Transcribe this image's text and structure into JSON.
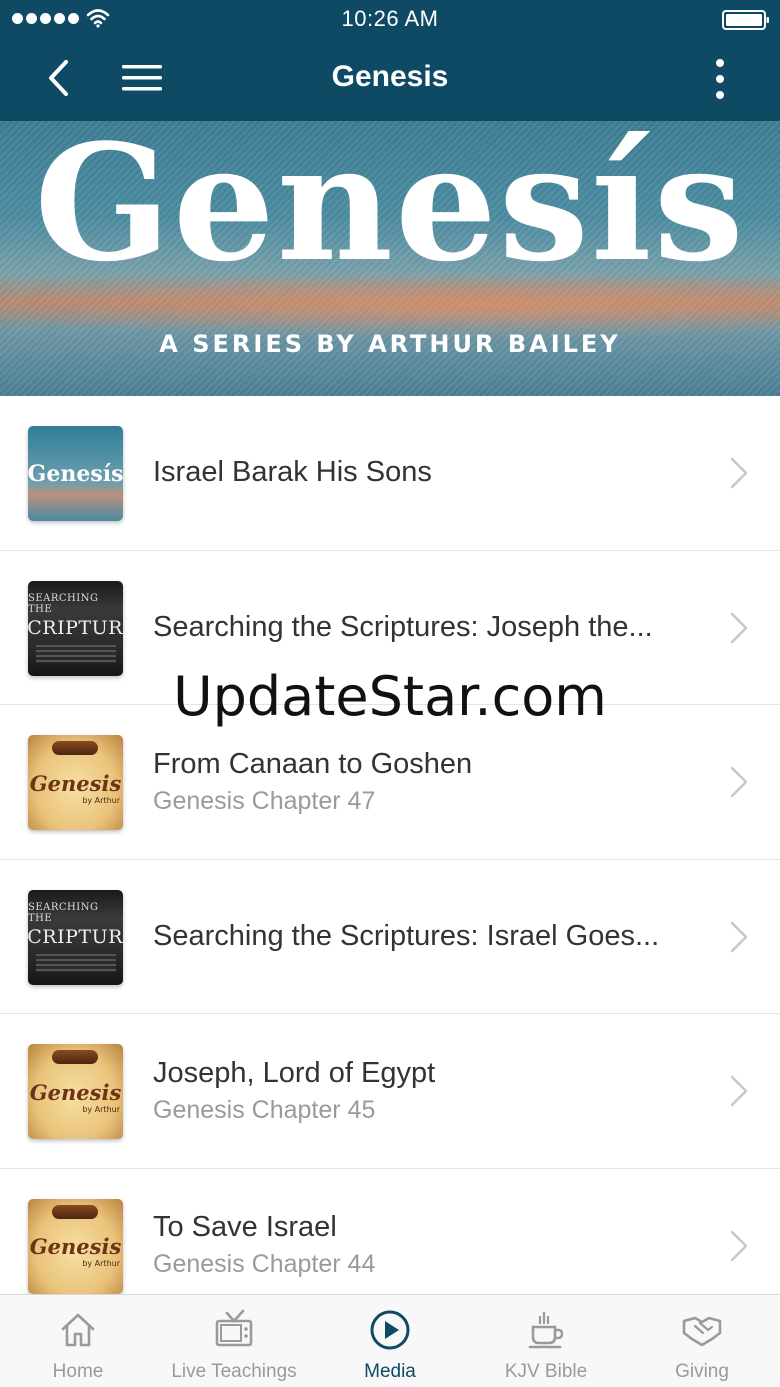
{
  "status_bar": {
    "time": "10:26 AM"
  },
  "nav": {
    "title": "Genesis"
  },
  "banner": {
    "title": "Genesís",
    "subtitle": "A SERIES BY ARTHUR BAILEY"
  },
  "list": {
    "items": [
      {
        "title": "Israel Barak His Sons",
        "subtitle": "",
        "thumb": "genesis-teal",
        "thumb_text": "Genesís"
      },
      {
        "title": "Searching the Scriptures: Joseph the...",
        "subtitle": "",
        "thumb": "searching-scriptures",
        "thumb_small": "SEARCHING THE",
        "thumb_big": "SCRIPTURE"
      },
      {
        "title": "From Canaan to Goshen",
        "subtitle": "Genesis Chapter 47",
        "thumb": "genesis-parchment",
        "thumb_text": "Genesis",
        "thumb_by": "by Arthur"
      },
      {
        "title": "Searching the Scriptures: Israel Goes...",
        "subtitle": "",
        "thumb": "searching-scriptures",
        "thumb_small": "SEARCHING THE",
        "thumb_big": "SCRIPTURE"
      },
      {
        "title": "Joseph, Lord of Egypt",
        "subtitle": "Genesis Chapter 45",
        "thumb": "genesis-parchment",
        "thumb_text": "Genesis",
        "thumb_by": "by Arthur"
      },
      {
        "title": "To Save Israel",
        "subtitle": "Genesis Chapter 44",
        "thumb": "genesis-parchment",
        "thumb_text": "Genesis",
        "thumb_by": "by Arthur"
      }
    ]
  },
  "watermark": "UpdateStar.com",
  "tabbar": {
    "tabs": [
      {
        "label": "Home",
        "icon": "home-icon",
        "active": false
      },
      {
        "label": "Live Teachings",
        "icon": "tv-icon",
        "active": false
      },
      {
        "label": "Media",
        "icon": "play-circle-icon",
        "active": true
      },
      {
        "label": "KJV Bible",
        "icon": "coffee-cup-icon",
        "active": false
      },
      {
        "label": "Giving",
        "icon": "handshake-icon",
        "active": false
      }
    ]
  },
  "colors": {
    "nav_bg": "#0e4a63",
    "accent": "#0e4a63",
    "inactive": "#9a9a9a"
  }
}
